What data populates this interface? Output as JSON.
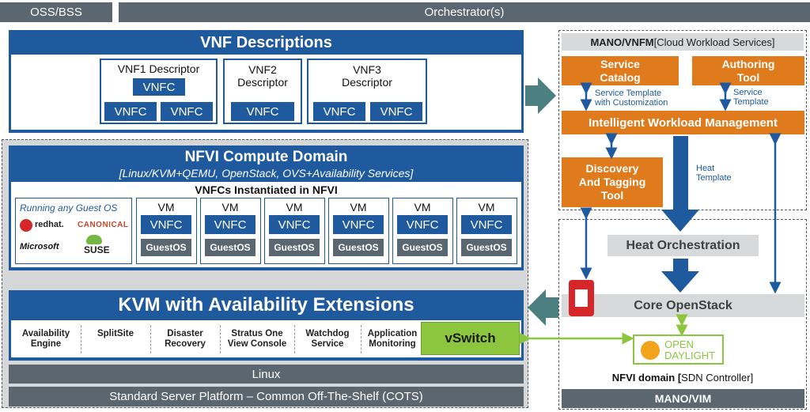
{
  "top": {
    "oss": "OSS/BSS",
    "orchestrator": "Orchestrator(s)"
  },
  "vnf": {
    "title": "VNF Descriptions",
    "descriptors": [
      {
        "title": "VNF1 Descriptor",
        "vnfcs": [
          "VNFC",
          "VNFC",
          "VNFC"
        ]
      },
      {
        "title_l1": "VNF2",
        "title_l2": "Descriptor",
        "vnfcs": [
          "VNFC"
        ]
      },
      {
        "title_l1": "VNF3",
        "title_l2": "Descriptor",
        "vnfcs": [
          "VNFC",
          "VNFC"
        ]
      }
    ]
  },
  "nfvi": {
    "title": "NFVI Compute Domain",
    "subtitle": "[Linux/KVM+QEMU, OpenStack, OVS+Availability Services]",
    "inst_title": "VNFCs Instantiated in NFVI",
    "guest_label": "Running any Guest OS",
    "logos": [
      "redhat.",
      "CANONICAL",
      "Microsoft",
      "SUSE"
    ],
    "vm_label": "VM",
    "vnfc_label": "VNFC",
    "guestos_label": "GuestOS"
  },
  "kvm": {
    "title": "KVM with Availability Extensions",
    "components": [
      {
        "l1": "Availability",
        "l2": "Engine"
      },
      {
        "l1": "SplitSite",
        "l2": ""
      },
      {
        "l1": "Disaster",
        "l2": "Recovery"
      },
      {
        "l1": "Stratus One",
        "l2": "View Console"
      },
      {
        "l1": "Watchdog",
        "l2": "Service"
      },
      {
        "l1": "Application",
        "l2": "Monitoring"
      }
    ],
    "vswitch": "vSwitch"
  },
  "bottom": {
    "linux": "Linux",
    "cots": "Standard Server Platform – Common Off-The-Shelf (COTS)"
  },
  "mano": {
    "title_bold": "MANO/VNFM",
    "title_rest": " [Cloud Workload Services]",
    "service_catalog_l1": "Service",
    "service_catalog_l2": "Catalog",
    "authoring_l1": "Authoring",
    "authoring_l2": "Tool",
    "st_custom_l1": "Service Template",
    "st_custom_l2": "with Customization",
    "st_l1": "Service",
    "st_l2": "Template",
    "iwm": "Intelligent Workload Management",
    "discovery_l1": "Discovery",
    "discovery_l2": "And Tagging",
    "discovery_l3": "Tool",
    "heat_template_l1": "Heat",
    "heat_template_l2": "Template"
  },
  "vim": {
    "heat_orch": "Heat Orchestration",
    "core": "Core OpenStack",
    "odl_l1": "OPEN",
    "odl_l2": "DAYLIGHT",
    "nfvi_domain_bold": "NFVI domain [",
    "nfvi_domain_rest": "SDN Controller]",
    "footer": "MANO/VIM"
  },
  "colors": {
    "blue": "#1f5a9e",
    "orange": "#e07b1d",
    "grey": "#5b6770",
    "green": "#8cc63f",
    "red": "#d5262a"
  }
}
